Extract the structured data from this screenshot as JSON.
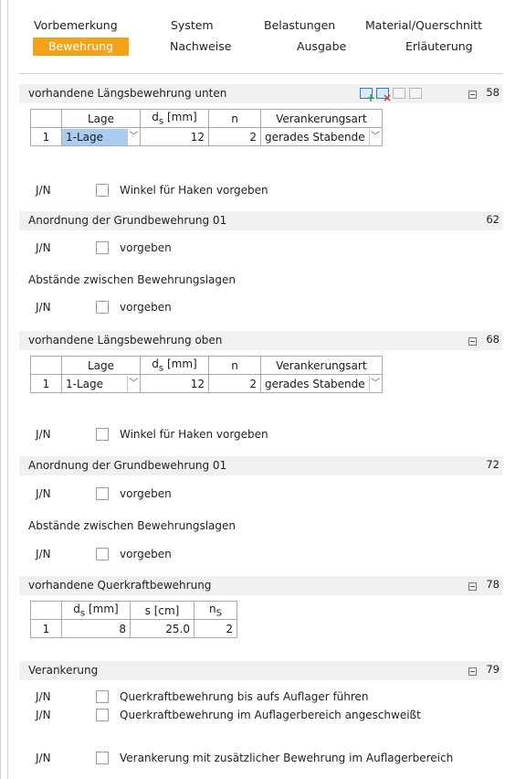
{
  "tabs": {
    "row1": [
      "Vorbemerkung",
      "System",
      "Belastungen",
      "Material/Querschnitt"
    ],
    "row2": [
      "Bewehrung",
      "Nachweise",
      "Ausgabe",
      "Erläuterung"
    ],
    "active": "Bewehrung",
    "active_color": "#f5a21b"
  },
  "jn_label": "J/N",
  "sec1": {
    "title": "vorhandene Längsbewehrung unten",
    "num": "58",
    "icons": [
      "add-row-icon",
      "delete-row-icon",
      "insert-row-icon",
      "clear-row-icon"
    ],
    "headers": [
      "",
      "Lage",
      "d",
      "s",
      "[mm]",
      "n",
      "Verankerungsart"
    ],
    "row": {
      "idx": "1",
      "lage": "1-Lage",
      "ds": "12",
      "n": "2",
      "art": "gerades Stabende"
    },
    "check_label": "Winkel für Haken vorgeben"
  },
  "sec2": {
    "title": "Anordnung der Grundbewehrung 01",
    "num": "62",
    "check_label": "vorgeben"
  },
  "sub1": {
    "title": "Abstände zwischen Bewehrungslagen",
    "check_label": "vorgeben"
  },
  "sec3": {
    "title": "vorhandene Längsbewehrung oben",
    "num": "68",
    "row": {
      "idx": "1",
      "lage": "1-Lage",
      "ds": "12",
      "n": "2",
      "art": "gerades Stabende"
    },
    "check_label": "Winkel für Haken vorgeben"
  },
  "sec4": {
    "title": "Anordnung der Grundbewehrung 01",
    "num": "72",
    "check_label": "vorgeben"
  },
  "sub2": {
    "title": "Abstände zwischen Bewehrungslagen",
    "check_label": "vorgeben"
  },
  "sec5": {
    "title": "vorhandene Querkraftbewehrung",
    "num": "78",
    "headers": {
      "ds": "d",
      "ds_sub": "s",
      "ds_unit": "[mm]",
      "s": "s [cm]",
      "n": "n",
      "n_sub": "S"
    },
    "row": {
      "idx": "1",
      "ds": "8",
      "s": "25.0",
      "n": "2"
    }
  },
  "sec6": {
    "title": "Verankerung",
    "num": "79",
    "checks": [
      "Querkraftbewehrung bis aufs Auflager führen",
      "Querkraftbewehrung im Auflagerbereich angeschweißt",
      "Verankerung mit zusätzlicher Bewehrung im Auflagerbereich"
    ]
  }
}
